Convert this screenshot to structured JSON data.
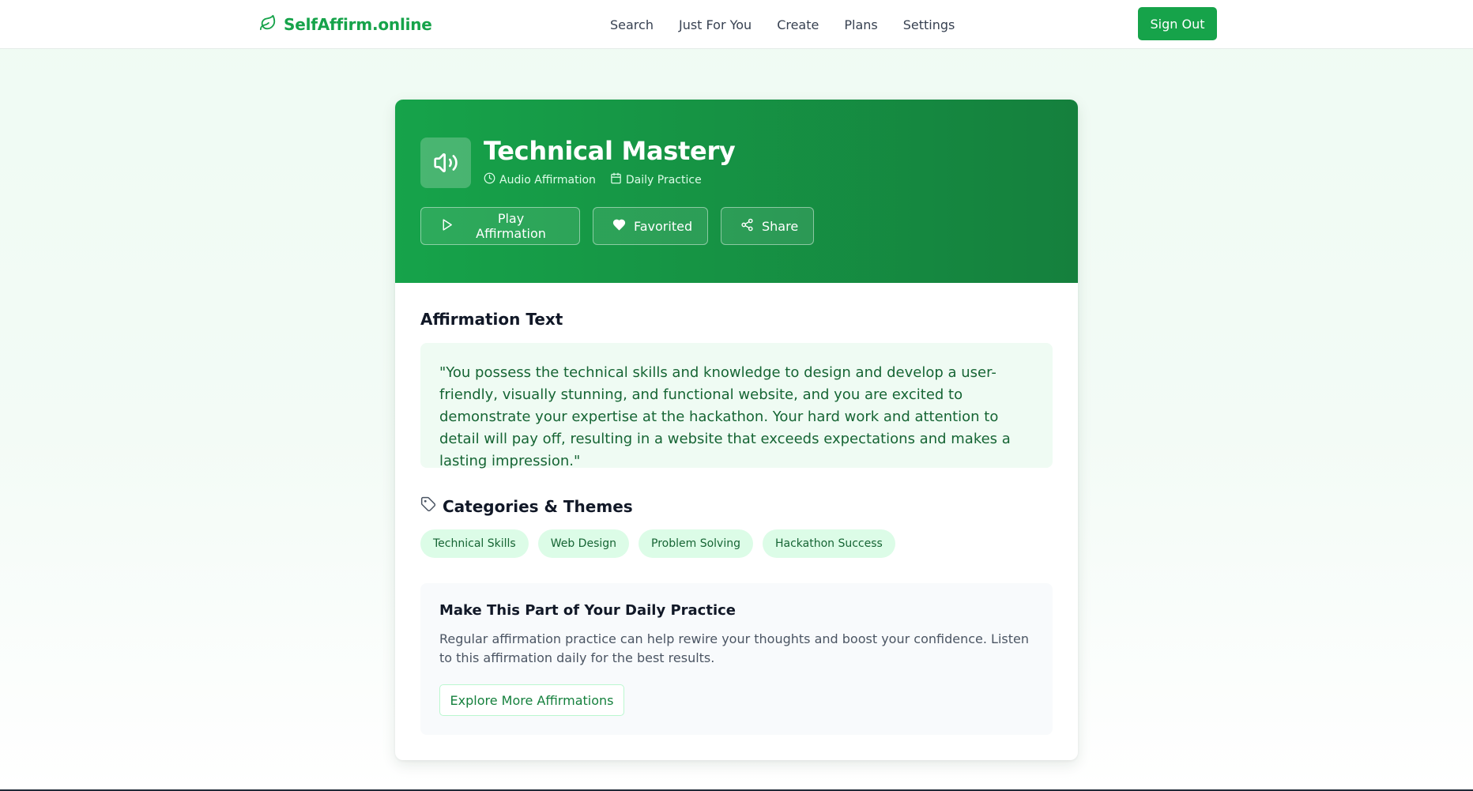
{
  "brand": {
    "name": "SelfAffirm.online",
    "icon": "leaf-icon",
    "color": "#16a34a"
  },
  "nav": {
    "items": [
      "Search",
      "Just For You",
      "Create",
      "Plans",
      "Settings"
    ],
    "sign_out": "Sign Out"
  },
  "affirmation": {
    "title": "Technical Mastery",
    "meta": {
      "type": "Audio Affirmation",
      "frequency": "Daily Practice"
    },
    "actions": {
      "play": "Play Affirmation",
      "favorite": "Favorited",
      "share": "Share"
    },
    "text_heading": "Affirmation Text",
    "text": "\"You possess the technical skills and knowledge to design and develop a user-friendly, visually stunning, and functional website, and you are excited to demonstrate your expertise at the hackathon. Your hard work and attention to detail will pay off, resulting in a website that exceeds expectations and makes a lasting impression.\"",
    "categories_heading": "Categories & Themes",
    "categories": [
      "Technical Skills",
      "Web Design",
      "Problem Solving",
      "Hackathon Success"
    ]
  },
  "practice": {
    "heading": "Make This Part of Your Daily Practice",
    "body": "Regular affirmation practice can help rewire your thoughts and boost your confidence. Listen to this affirmation daily for the best results.",
    "button": "Explore More Affirmations"
  },
  "colors": {
    "accent": "#16a34a",
    "accent_dark": "#15803d",
    "chip_bg": "#dcfce7",
    "quote_text": "#166534"
  }
}
